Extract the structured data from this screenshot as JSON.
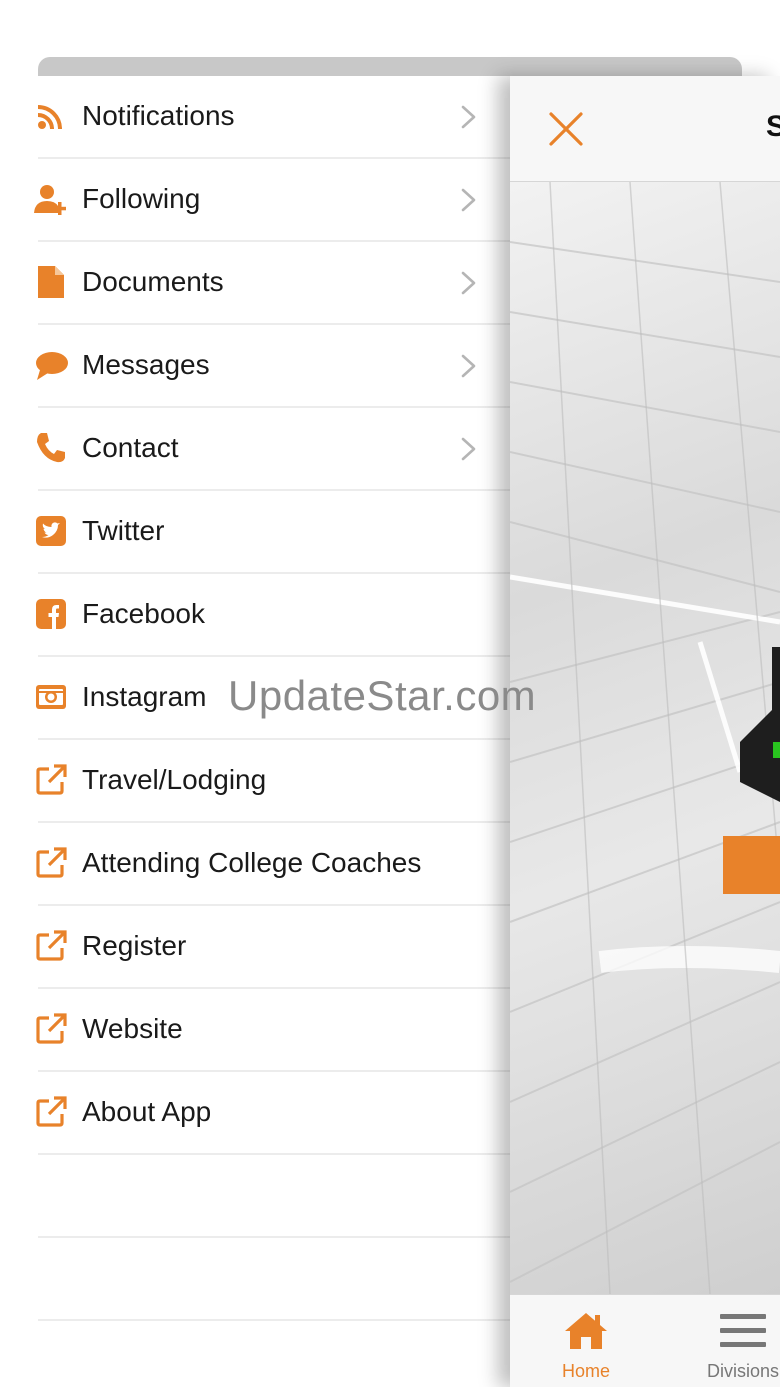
{
  "colors": {
    "accent": "#E8822A",
    "text": "#1a1a1a",
    "separator": "#ececec",
    "chevron": "#b5b5b5"
  },
  "menu": {
    "items": [
      {
        "label": "Notifications",
        "icon": "rss-icon",
        "has_chevron": true
      },
      {
        "label": "Following",
        "icon": "user-plus-icon",
        "has_chevron": true
      },
      {
        "label": "Documents",
        "icon": "document-icon",
        "has_chevron": true
      },
      {
        "label": "Messages",
        "icon": "chat-bubble-icon",
        "has_chevron": true
      },
      {
        "label": "Contact",
        "icon": "phone-icon",
        "has_chevron": true
      },
      {
        "label": "Twitter",
        "icon": "twitter-icon",
        "has_chevron": false
      },
      {
        "label": "Facebook",
        "icon": "facebook-icon",
        "has_chevron": false
      },
      {
        "label": "Instagram",
        "icon": "instagram-icon",
        "has_chevron": false
      },
      {
        "label": "Travel/Lodging",
        "icon": "external-link-icon",
        "has_chevron": false
      },
      {
        "label": "Attending College Coaches",
        "icon": "external-link-icon",
        "has_chevron": false
      },
      {
        "label": "Register",
        "icon": "external-link-icon",
        "has_chevron": false
      },
      {
        "label": "Website",
        "icon": "external-link-icon",
        "has_chevron": false
      },
      {
        "label": "About App",
        "icon": "external-link-icon",
        "has_chevron": false
      }
    ]
  },
  "watermark": "UpdateStar.com",
  "panel": {
    "title": "S"
  },
  "tabbar": {
    "tabs": [
      {
        "label": "Home",
        "icon": "home-icon",
        "active": true
      },
      {
        "label": "Divisions",
        "icon": "hamburger-icon",
        "active": false
      }
    ]
  }
}
